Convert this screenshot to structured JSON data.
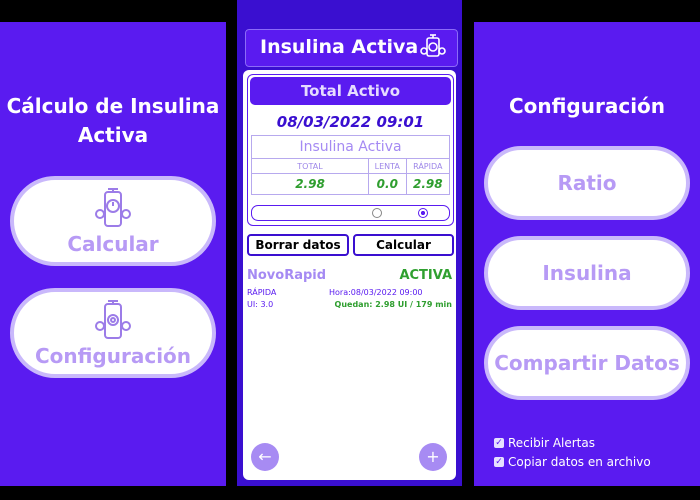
{
  "left": {
    "title_line1": "Cálculo de Insulina",
    "title_line2": "Activa",
    "buttons": [
      {
        "label": "Calcular",
        "icon": "pen-timer-icon"
      },
      {
        "label": "Configuración",
        "icon": "pen-gear-icon"
      }
    ]
  },
  "center": {
    "app_title": "Insulina Activa",
    "header_icon": "insulin-pen-icon",
    "card": {
      "header": "Total Activo",
      "datetime": "08/03/2022 09:01",
      "table_caption": "Insulina Activa",
      "columns": [
        "TOTAL",
        "LENTA",
        "RÁPIDA"
      ],
      "values": [
        "2.98",
        "0.0",
        "2.98"
      ]
    },
    "buttons": {
      "clear": "Borrar datos",
      "calc": "Calcular"
    },
    "entry": {
      "name": "NovoRapid",
      "status": "ACTIVA",
      "type": "RÁPIDA",
      "time": "Hora:08/03/2022 09:00",
      "units": "UI: 3.0",
      "remaining": "Quedan: 2.98 UI / 179 min"
    },
    "fab_back": "←",
    "fab_add": "+"
  },
  "right": {
    "title": "Configuración",
    "buttons": [
      "Ratio",
      "Insulina",
      "Compartir Datos"
    ],
    "checks": [
      {
        "label": "Recibir Alertas",
        "checked": true
      },
      {
        "label": "Copiar datos en archivo",
        "checked": true
      }
    ]
  },
  "colors": {
    "primary": "#5a1bf0",
    "dark": "#3a0fd0",
    "lavender": "#b79af5",
    "green": "#2f9e2f"
  }
}
